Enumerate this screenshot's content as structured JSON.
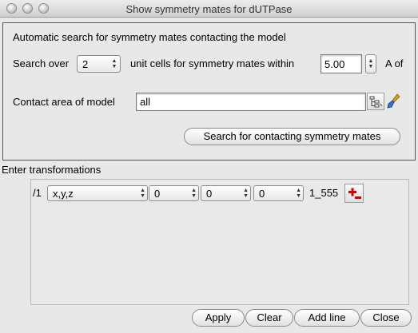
{
  "window": {
    "title": "Show symmetry mates for dUTPase"
  },
  "search_panel": {
    "heading": "Automatic search for symmetry mates contacting the model",
    "search_over_label": "Search over",
    "unit_cells_value": "2",
    "unit_cells_label": "unit cells for symmetry mates within",
    "distance_value": "5.00",
    "distance_unit_label": "A of",
    "contact_area_label": "Contact area of model",
    "contact_area_value": "all",
    "search_button_label": "Search for contacting symmetry mates"
  },
  "transformations": {
    "label": "Enter transformations",
    "rows": [
      {
        "index_label": "/1",
        "operator": "x,y,z",
        "shift_a": "0",
        "shift_b": "0",
        "shift_c": "0",
        "symop_code": "1_555"
      }
    ]
  },
  "buttons": {
    "apply": "Apply",
    "clear": "Clear",
    "add_line": "Add line",
    "close": "Close"
  },
  "colors": {
    "delete_icon": "#d10000",
    "brush_handle": "#d9a21b",
    "brush_head": "#3b6fd1"
  }
}
